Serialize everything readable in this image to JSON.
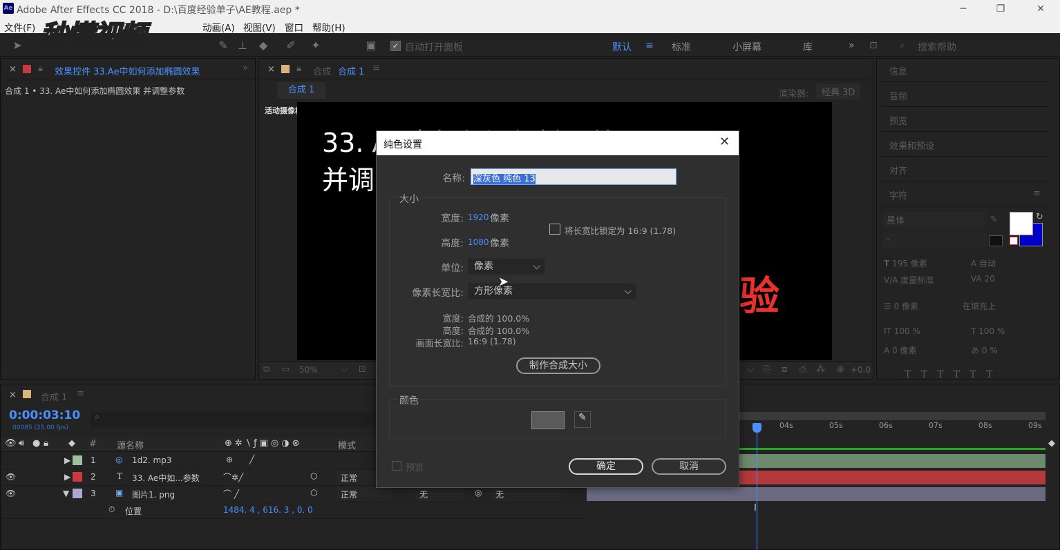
{
  "window": {
    "title": "Adobe After Effects CC 2018 - D:\\百度经验单子\\AE教程.aep *",
    "app_logo": "Ae"
  },
  "menu": [
    "文件(F)",
    "图层",
    "动画(A)",
    "视图(V)",
    "窗口",
    "帮助(H)"
  ],
  "watermark": "秒懂视频",
  "toolbar": {
    "auto_open": "自动打开面板",
    "workspaces": [
      "默认",
      "标准",
      "小屏幕",
      "库"
    ],
    "search_placeholder": "搜索帮助"
  },
  "effects_panel": {
    "tab": "效果控件 33.Ae中如何添加椭圆效果",
    "subtitle": "合成 1 • 33. Ae中如何添加椭圆效果 并调整参数"
  },
  "comp_panel": {
    "tab_prefix": "合成",
    "tab_name": "合成 1",
    "sub_tab": "合成 1",
    "renderer_label": "渲染器:",
    "renderer": "经典 3D",
    "camera": "活动摄像机",
    "text_line1": "33. AE中如何添加椭圆效果",
    "text_line2": "并调",
    "text_red": "验",
    "zoom": "50%",
    "exposure": "+0.0"
  },
  "right_panel": {
    "sections": [
      "信息",
      "音频",
      "预览",
      "效果和预设",
      "对齐",
      "字符"
    ],
    "font": "黑体",
    "font_style": "-",
    "size": "195 像素",
    "leading": "自动",
    "kerning": "度量标准",
    "tracking": "20",
    "stroke": "0 像素",
    "stroke_type": "在填充上",
    "vscale": "100 %",
    "hscale": "100 %",
    "baseline": "0 像素",
    "tsume": "0 %",
    "fill_color": "#ffffff",
    "stroke_color": "#0000c8"
  },
  "dialog": {
    "title": "纯色设置",
    "name_label": "名称:",
    "name_value": "深灰色 纯色 13",
    "size_group": "大小",
    "width_label": "宽度:",
    "width_value": "1920",
    "width_unit": "像素",
    "height_label": "高度:",
    "height_value": "1080",
    "height_unit": "像素",
    "lock_label": "将长宽比锁定为 16:9 (1.78)",
    "unit_label": "单位:",
    "unit_value": "像素",
    "par_label": "像素长宽比:",
    "par_value": "方形像素",
    "info_width_label": "宽度:",
    "info_width_value": "合成的 100.0%",
    "info_height_label": "高度:",
    "info_height_value": "合成的 100.0%",
    "frame_ar_label": "画面长宽比:",
    "frame_ar_value": "16:9 (1.78)",
    "make_comp_size": "制作合成大小",
    "color_group": "颜色",
    "swatch_color": "#5a5a5a",
    "preview_label": "预览",
    "ok": "确定",
    "cancel": "取消"
  },
  "timeline": {
    "tab": "合成 1",
    "timecode": "0:00:03:10",
    "fps": "00085 (25.00 fps)",
    "col_source": "源名称",
    "col_mode": "模式",
    "col_hash": "#",
    "layers": [
      {
        "num": "1",
        "type": "audio",
        "name": "1d2. mp3",
        "mode": "",
        "color": "#9fbf9f"
      },
      {
        "num": "2",
        "type": "T",
        "name": "33. Ae中如...参数",
        "mode": "正常",
        "color": "#c43c3c"
      },
      {
        "num": "3",
        "type": "image",
        "name": "图片1. png",
        "mode": "正常",
        "color": "#a9a9d2",
        "trkmat": "无",
        "parent": "无"
      }
    ],
    "property": {
      "name": "位置",
      "value": "1484. 4 , 616. 3 , 0. 0"
    },
    "ruler": [
      "04s",
      "05s",
      "06s",
      "07s",
      "08s",
      "09s"
    ],
    "bar_colors": [
      "#6e8a6e",
      "#b23a3a",
      "#6a6a80"
    ]
  }
}
